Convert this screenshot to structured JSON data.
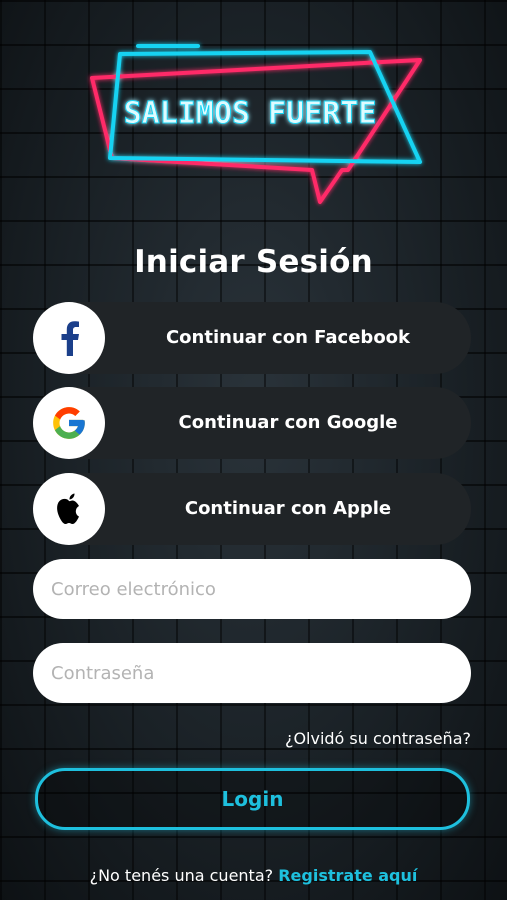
{
  "logo": {
    "text": "SALIMOS FUERTE"
  },
  "title": "Iniciar Sesión",
  "social": [
    {
      "label": "Continuar con Facebook",
      "icon": "facebook-icon"
    },
    {
      "label": "Continuar con Google",
      "icon": "google-icon"
    },
    {
      "label": "Continuar con Apple",
      "icon": "apple-icon"
    }
  ],
  "form": {
    "email_placeholder": "Correo electrónico",
    "password_placeholder": "Contraseña",
    "forgot": "¿Olvidó su contraseña?",
    "login": "Login"
  },
  "signup": {
    "prompt": "¿No tenés una cuenta?",
    "link": "Registrate aquí"
  },
  "colors": {
    "accent": "#1ec0de",
    "neon_pink": "#ff2a68",
    "neon_cyan": "#19d3f2",
    "button_bg": "#202427"
  }
}
